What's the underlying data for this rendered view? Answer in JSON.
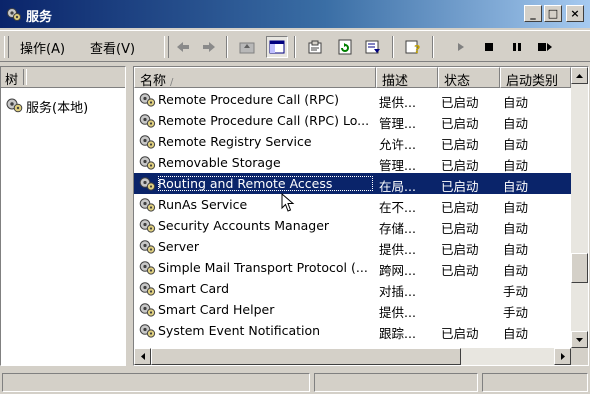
{
  "window": {
    "title": "服务",
    "buttons": {
      "minimize": "_",
      "maximize": "□",
      "close": "×"
    }
  },
  "menu": {
    "action": "操作(A)",
    "view": "查看(V)"
  },
  "toolbar": {
    "icons": [
      "back-icon",
      "forward-icon",
      "up-folder-icon",
      "show-hide-tree-icon",
      "properties-icon",
      "refresh-icon",
      "export-list-icon",
      "help-icon",
      "start-service-icon",
      "stop-service-icon",
      "pause-service-icon",
      "restart-service-icon"
    ]
  },
  "tree": {
    "header": "树",
    "root": "服务(本地)"
  },
  "list": {
    "columns": [
      "名称",
      "描述",
      "状态",
      "启动类别"
    ],
    "sort_indicator": "/",
    "rows": [
      {
        "name": "Remote Procedure Call (RPC)",
        "desc": "提供...",
        "status": "已启动",
        "startup": "自动"
      },
      {
        "name": "Remote Procedure Call (RPC) Lo...",
        "desc": "管理...",
        "status": "已启动",
        "startup": "自动"
      },
      {
        "name": "Remote Registry Service",
        "desc": "允许...",
        "status": "已启动",
        "startup": "自动"
      },
      {
        "name": "Removable Storage",
        "desc": "管理...",
        "status": "已启动",
        "startup": "自动"
      },
      {
        "name": "Routing and Remote Access",
        "desc": "在局...",
        "status": "已启动",
        "startup": "自动"
      },
      {
        "name": "RunAs Service",
        "desc": "在不...",
        "status": "已启动",
        "startup": "自动"
      },
      {
        "name": "Security Accounts Manager",
        "desc": "存储...",
        "status": "已启动",
        "startup": "自动"
      },
      {
        "name": "Server",
        "desc": "提供...",
        "status": "已启动",
        "startup": "自动"
      },
      {
        "name": "Simple Mail Transport Protocol (...",
        "desc": "跨网...",
        "status": "已启动",
        "startup": "自动"
      },
      {
        "name": "Smart Card",
        "desc": "对插...",
        "status": "",
        "startup": "手动"
      },
      {
        "name": "Smart Card Helper",
        "desc": "提供...",
        "status": "",
        "startup": "手动"
      },
      {
        "name": "System Event Notification",
        "desc": "跟踪...",
        "status": "已启动",
        "startup": "自动"
      }
    ],
    "selected_index": 4
  },
  "colors": {
    "title_bar": "#0a246a",
    "selection": "#0a246a",
    "face": "#d4d0c8"
  }
}
